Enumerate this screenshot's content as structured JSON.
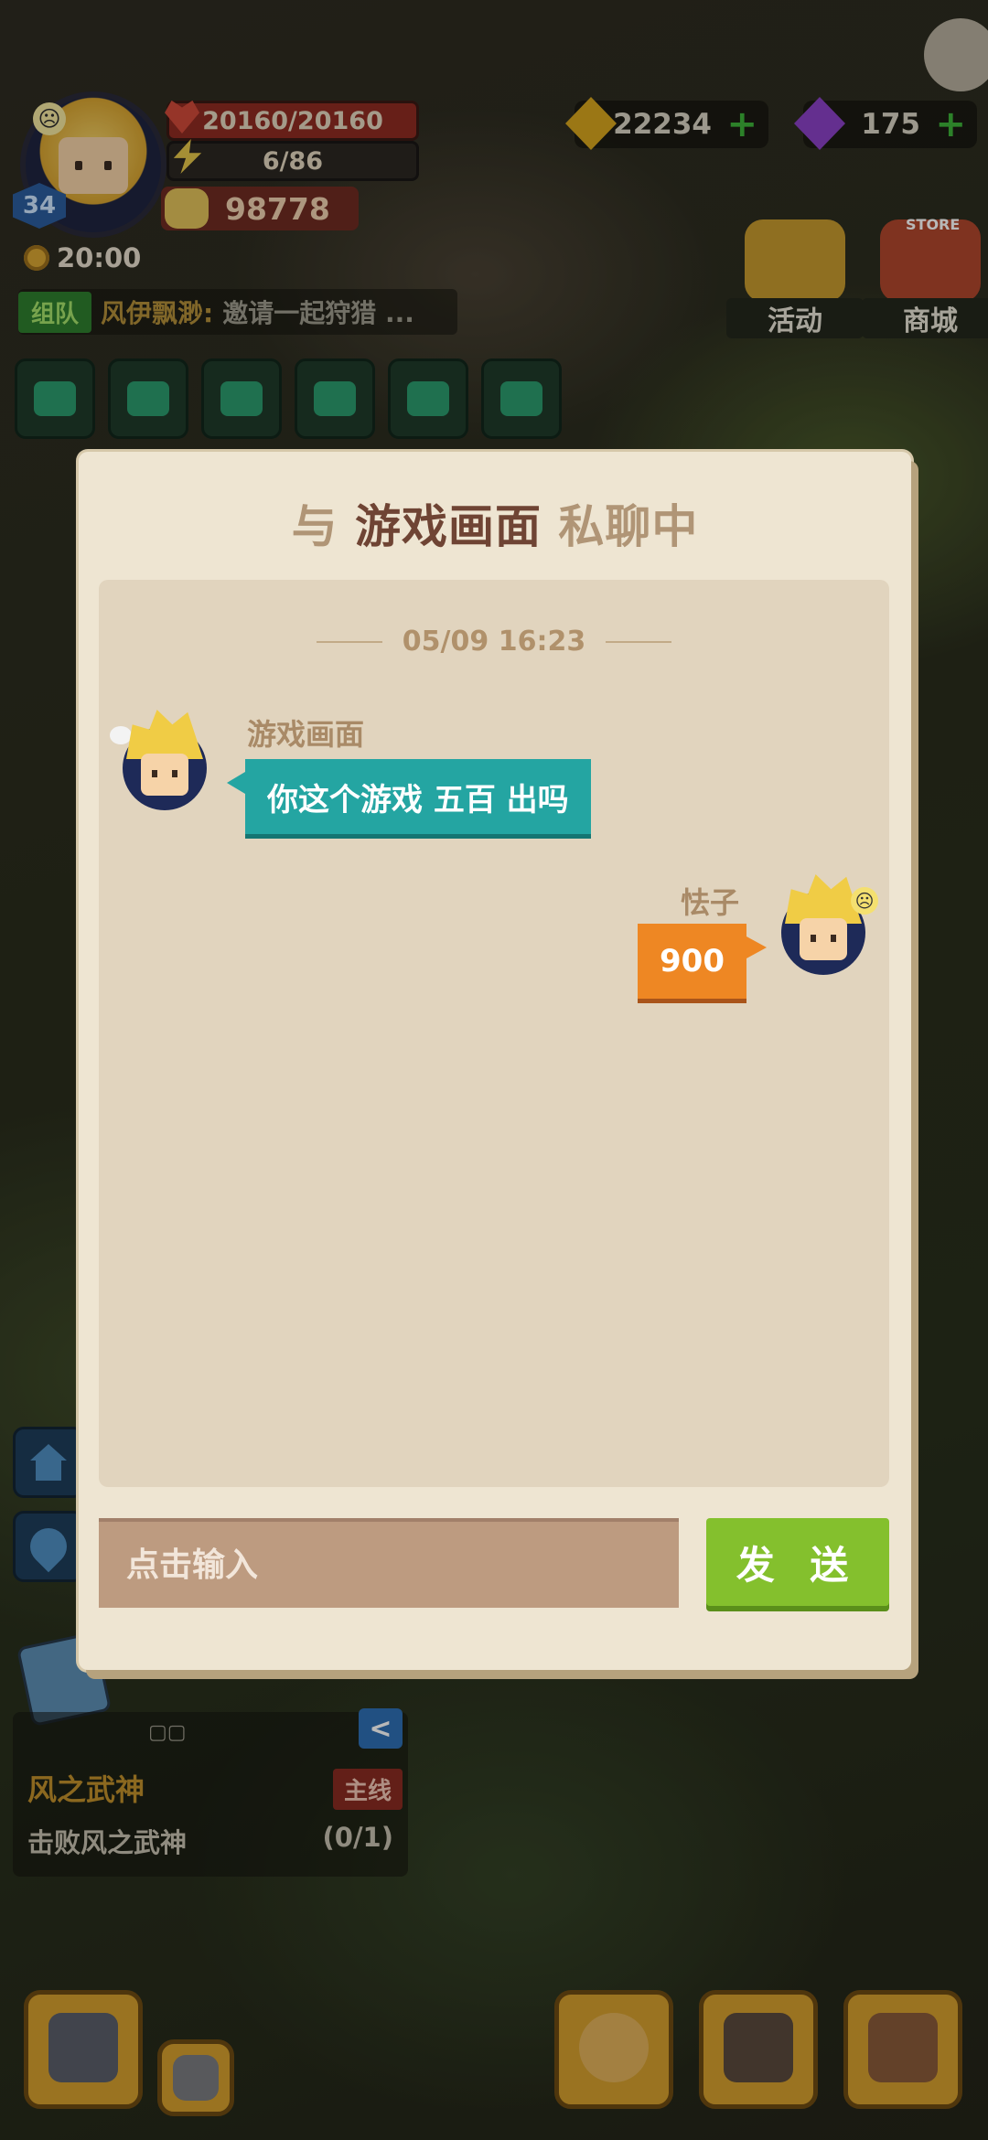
{
  "hud": {
    "level": "34",
    "hp": "20160/20160",
    "energy": "6/86",
    "power": "98778",
    "time": "20:00",
    "gold": "22234",
    "gems": "175",
    "activity_label": "活动",
    "shop_label": "商城",
    "store_tag": "STORE"
  },
  "ticker": {
    "tag": "组队",
    "name": "风伊飘渺:",
    "message": "邀请一起狩猎 ..."
  },
  "quest": {
    "dots": "▢▢",
    "title": "风之武神",
    "tag": "主线",
    "description": "击败风之武神",
    "progress": "(0/1)",
    "collapse": "<"
  },
  "chat": {
    "title_prefix": "与 ",
    "title_peer": "游戏画面",
    "title_suffix": " 私聊中",
    "date": "05/09 16:23",
    "messages": [
      {
        "sender": "游戏画面",
        "text": "你这个游戏 五百 出吗",
        "side": "left"
      },
      {
        "sender": "怯子",
        "text": "900",
        "side": "right"
      }
    ],
    "input_placeholder": "点击输入",
    "send_label": "发 送"
  },
  "icons": {
    "mood": "☹"
  }
}
